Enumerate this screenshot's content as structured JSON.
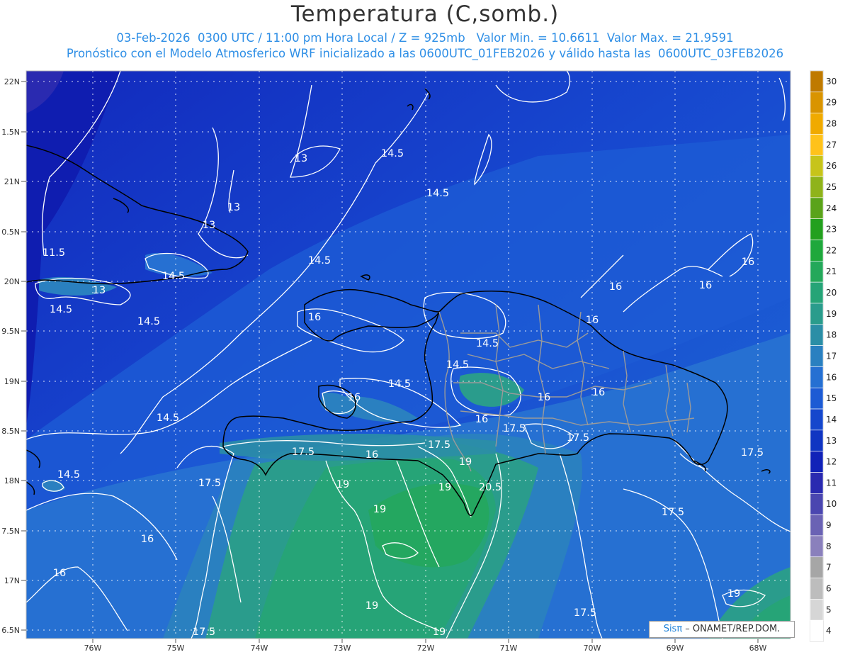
{
  "title": "Temperatura (C,somb.)",
  "subtitle_line1": "03-Feb-2026  0300 UTC / 11:00 pm Hora Local / Z = 925mb   Valor Min. = 10.6611  Valor Max. = 21.9591",
  "subtitle_line2": "Pronóstico con el Modelo Atmosferico WRF inicializado a las 0600UTC_01FEB2026 y válido hasta las  0600UTC_03FEB2026",
  "lat_labels": [
    "22N",
    "1.5N",
    "21N",
    "0.5N",
    "20N",
    "9.5N",
    "19N",
    "8.5N",
    "18N",
    "7.5N",
    "17N",
    "6.5N"
  ],
  "lon_labels": [
    "76W",
    "75W",
    "74W",
    "73W",
    "72W",
    "71W",
    "70W",
    "69W",
    "68W"
  ],
  "colorbar": {
    "labels": [
      "30",
      "29",
      "28",
      "27",
      "26",
      "25",
      "24",
      "23",
      "22",
      "21",
      "20",
      "19",
      "18",
      "17",
      "16",
      "15",
      "14",
      "13",
      "12",
      "11",
      "10",
      "9",
      "8",
      "7",
      "6",
      "5",
      "4"
    ],
    "colors": [
      "#bf7a00",
      "#d99400",
      "#f0aa00",
      "#ffc21a",
      "#c7c41a",
      "#8fb31a",
      "#5aa31a",
      "#23a01e",
      "#1fa83c",
      "#24a85a",
      "#26a477",
      "#2a9c8c",
      "#2b8ea6",
      "#2a80c0",
      "#2670d2",
      "#1d5bd4",
      "#1547cc",
      "#1035c2",
      "#1122b8",
      "#2a2ab0",
      "#4a46b0",
      "#6a62b4",
      "#8a80bc",
      "#a6a6a6",
      "#bdbdbd",
      "#d6d6d6",
      "#ffffff"
    ]
  },
  "contour_labels": [
    {
      "t": "13"
    },
    {
      "t": "13"
    },
    {
      "t": "13"
    },
    {
      "t": "13"
    },
    {
      "t": "11.5"
    },
    {
      "t": "14.5"
    },
    {
      "t": "14.5"
    },
    {
      "t": "14.5"
    },
    {
      "t": "14.5"
    },
    {
      "t": "14.5"
    },
    {
      "t": "14.5"
    },
    {
      "t": "14.5"
    },
    {
      "t": "14.5"
    },
    {
      "t": "14.5"
    },
    {
      "t": "14.5"
    },
    {
      "t": "16"
    },
    {
      "t": "16"
    },
    {
      "t": "16"
    },
    {
      "t": "16"
    },
    {
      "t": "16"
    },
    {
      "t": "16"
    },
    {
      "t": "16"
    },
    {
      "t": "16"
    },
    {
      "t": "16"
    },
    {
      "t": "16"
    },
    {
      "t": "17.5"
    },
    {
      "t": "17.5"
    },
    {
      "t": "17.5"
    },
    {
      "t": "17.5"
    },
    {
      "t": "17.5"
    },
    {
      "t": "17.5"
    },
    {
      "t": "17.5"
    },
    {
      "t": "17.5"
    },
    {
      "t": "19"
    },
    {
      "t": "19"
    },
    {
      "t": "19"
    },
    {
      "t": "19"
    },
    {
      "t": "19"
    },
    {
      "t": "19"
    },
    {
      "t": "19"
    },
    {
      "t": "20.5"
    },
    {
      "t": "16"
    },
    {
      "t": "14.5"
    }
  ],
  "credit": {
    "brand_a": "Sis",
    "brand_pi": "π",
    "brand_rest": " – ONAMET/REP.DOM."
  }
}
